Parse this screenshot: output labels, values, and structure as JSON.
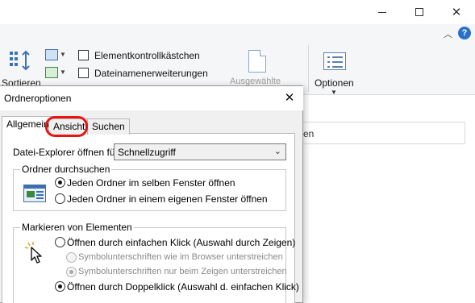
{
  "explorer": {
    "ribbon": {
      "sort_label": "Sortieren",
      "checkbox_1": "Elementkontrollkästchen",
      "checkbox_2": "Dateinamenerweiterungen",
      "selected_label": "Ausgewählte",
      "options_label": "Optionen"
    },
    "search_partial_text": "en"
  },
  "dialog": {
    "title": "Ordneroptionen",
    "tabs": [
      {
        "label": "Allgemein"
      },
      {
        "label": "Ansicht"
      },
      {
        "label": "Suchen"
      }
    ],
    "open_explorer_label": "Datei-Explorer öffnen für:",
    "open_explorer_value": "Schnellzugriff",
    "browse_group": {
      "legend": "Ordner durchsuchen",
      "options": [
        "Jeden Ordner im selben Fenster öffnen",
        "Jeden Ordner in einem eigenen Fenster öffnen"
      ]
    },
    "click_group": {
      "legend": "Markieren von Elementen",
      "single_click": "Öffnen durch einfachen Klick (Auswahl durch Zeigen)",
      "underline_browser": "Symbolunterschriften wie im Browser unterstreichen",
      "underline_hover": "Symbolunterschriften nur beim Zeigen unterstreichen",
      "double_click": "Öffnen durch Doppelklick (Auswahl d. einfachen Klick)"
    }
  },
  "colors": {
    "highlight_ring": "#e81414",
    "help_icon": "#2a6fc8"
  }
}
